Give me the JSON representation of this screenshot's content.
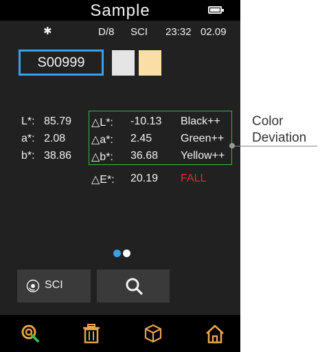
{
  "header": {
    "title": "Sample"
  },
  "status": {
    "bluetooth": "✱",
    "geometry": "D/8",
    "mode": "SCI",
    "time": "23:32",
    "date": "02.09"
  },
  "sample": {
    "id": "S00999",
    "swatch_reference_color": "#e5e5e5",
    "swatch_sample_color": "#f9dfa6"
  },
  "lab": [
    {
      "label": "L*:",
      "value": "85.79"
    },
    {
      "label": "a*:",
      "value": "2.08"
    },
    {
      "label": "b*:",
      "value": "38.86"
    }
  ],
  "deviation": [
    {
      "label": "△L*:",
      "value": "-10.13",
      "assessment": "Black++"
    },
    {
      "label": "△a*:",
      "value": "2.45",
      "assessment": "Green++"
    },
    {
      "label": "△b*:",
      "value": "36.68",
      "assessment": "Yellow++"
    }
  ],
  "delta_e": {
    "label": "△E*:",
    "value": "20.19",
    "result": "FALL"
  },
  "pager": {
    "current_page": 1,
    "total_pages": 2
  },
  "buttons": {
    "sci_label": "SCI",
    "sci_icon": "measure-mode-icon",
    "search_icon": "search-icon"
  },
  "nav": [
    "measure-icon",
    "trash-icon",
    "box-icon",
    "home-icon"
  ],
  "annotation": {
    "line1": "Color",
    "line2": "Deviation"
  },
  "colors": {
    "accent_blue": "#3aa0e6",
    "box_green": "#3bb54a",
    "fail_red": "#e0282e",
    "nav_orange": "#e8a54a"
  }
}
